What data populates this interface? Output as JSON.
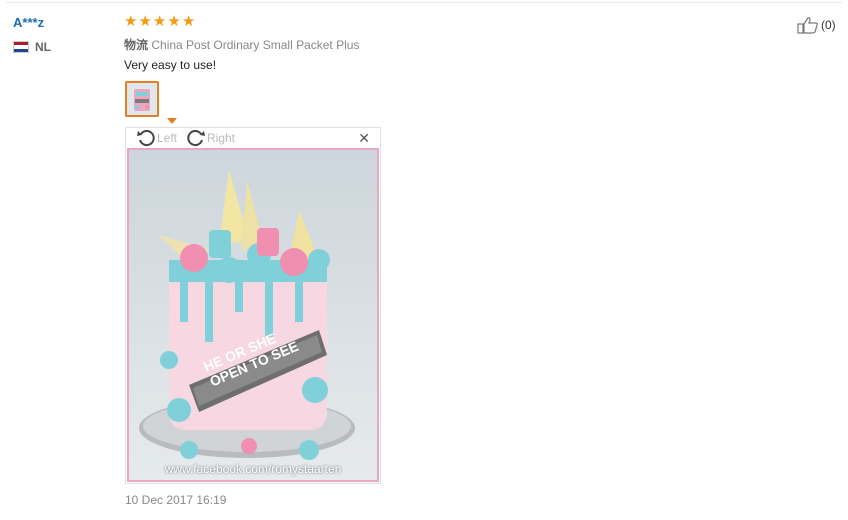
{
  "reviewer": {
    "name": "A***z",
    "country_code": "NL",
    "flag_colors": [
      "#ae1c28",
      "#ffffff",
      "#21468b"
    ]
  },
  "review": {
    "rating": 5,
    "star_color": "#f39c12",
    "logistics_label": "物流",
    "logistics_value": "China Post Ordinary Small Packet Plus",
    "text": "Very easy to use!",
    "date": "10 Dec 2017 16:19"
  },
  "viewer": {
    "rotate_left_label": "Left",
    "rotate_right_label": "Right",
    "close_icon": "close-icon",
    "photo_watermark": "www.facebook.com/romystaarten",
    "banner_text_line1": "HE OR SHE",
    "banner_text_line2": "OPEN TO SEE"
  },
  "helpful": {
    "count_text": "(0)",
    "icon": "thumbs-up-icon"
  }
}
